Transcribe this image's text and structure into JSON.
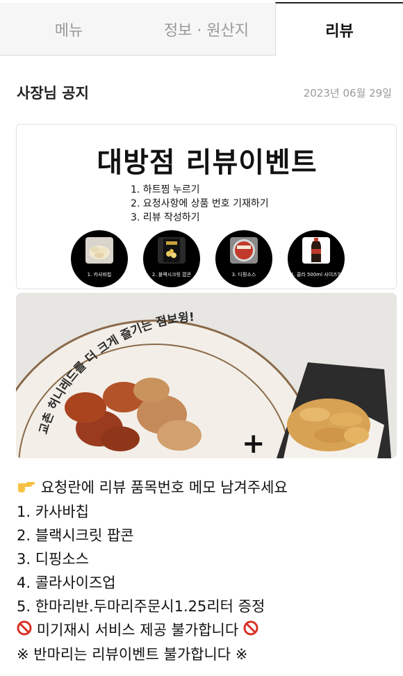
{
  "tabs": [
    {
      "label": "메뉴",
      "active": false
    },
    {
      "label": "정보 · 원산지",
      "active": false
    },
    {
      "label": "리뷰",
      "active": true
    }
  ],
  "notice": {
    "title": "사장님 공지",
    "date": "2023년 06월 29일"
  },
  "event": {
    "title": "대방점 리뷰이벤트",
    "steps": [
      "1. 하트찜 누르기",
      "2. 요청사항에 상품 번호 기재하기",
      "3. 리뷰 작성하기"
    ],
    "items": [
      {
        "caption": "1. 카사바칩"
      },
      {
        "caption": "2. 블랙시크릿 팝콘"
      },
      {
        "caption": "3. 디핑소스"
      },
      {
        "caption": "4. 콜라 500ml 사이즈업"
      }
    ]
  },
  "photo": {
    "plate_text": "교촌 허니레드를 더 크게 즐기는 점보윙!",
    "plus": "+"
  },
  "body": {
    "lines": [
      "요청란에 리뷰 품목번호 메모 남겨주세요",
      "1. 카사바칩",
      "2. 블랙시크릿 팝콘",
      "3. 디핑소스",
      "4. 콜라사이즈업",
      "5. 한마리반.두마리주문시1.25리터 증정",
      "미기재시 서비스 제공 불가합니다",
      "※ 반마리는 리뷰이벤트 불가합니다 ※"
    ]
  },
  "icons": {
    "pointing": "pointing-hand-icon",
    "prohibited": "prohibited-icon"
  }
}
